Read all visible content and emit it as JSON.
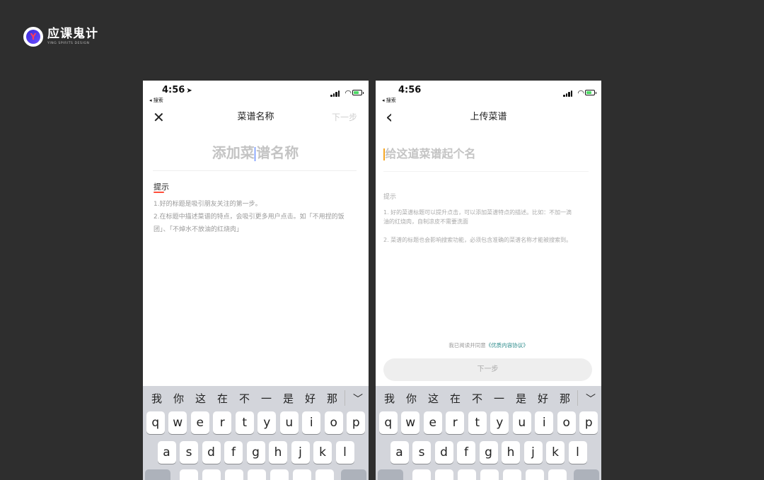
{
  "brand": {
    "name": "应课鬼计",
    "subtitle": "YING SPIRITS DESIGN",
    "logo_letter": "Y"
  },
  "left_screen": {
    "status": {
      "time": "4:56",
      "location_arrow": "➤",
      "back_app": "◂ 搜索"
    },
    "nav": {
      "close_icon": "✕",
      "title": "菜谱名称",
      "next": "下一步"
    },
    "name_placeholder_a": "添加菜",
    "name_placeholder_b": "谱名称",
    "tip_title": "提示",
    "tip_line1": "1.好的标题是吸引朋友关注的第一步。",
    "tip_line2": "2.在标题中描述菜谱的特点，会吸引更多用户点击。如「不用捏的饭团」、「不焯水不放油的红烧肉」"
  },
  "right_screen": {
    "status": {
      "time": "4:56",
      "back_app": "◂ 搜索"
    },
    "nav": {
      "back_icon": "‹",
      "title": "上传菜谱"
    },
    "name_placeholder": "给这道菜谱起个名",
    "tip_title": "提示",
    "tip_p1": "1. 好的菜谱标题可以提升点击，可以添加菜谱特点的描述。比如：不加一滴油的红烧肉，自制凉皮不需要洗面",
    "tip_p2": "2. 菜谱的标题也会影响搜索功能，必须包含准确的菜谱名称才能被搜索到。",
    "agree_prefix": "我已阅读并同意",
    "agree_link": "《优质内容协议》",
    "next_button": "下一步"
  },
  "keyboard": {
    "candidates": [
      "我",
      "你",
      "这",
      "在",
      "不",
      "一",
      "是",
      "好",
      "那"
    ],
    "candidate_tail": "​",
    "collapse_icon": "﹀",
    "row1": [
      "q",
      "w",
      "e",
      "r",
      "t",
      "y",
      "u",
      "i",
      "o",
      "p"
    ],
    "row2": [
      "a",
      "s",
      "d",
      "f",
      "g",
      "h",
      "j",
      "k",
      "l"
    ]
  },
  "colors": {
    "background": "#2e2e2e",
    "accent_red": "#ff4d3a",
    "link_teal": "#2a8a8a",
    "caret_orange": "#f5a623",
    "caret_blue": "#3a6bff"
  }
}
